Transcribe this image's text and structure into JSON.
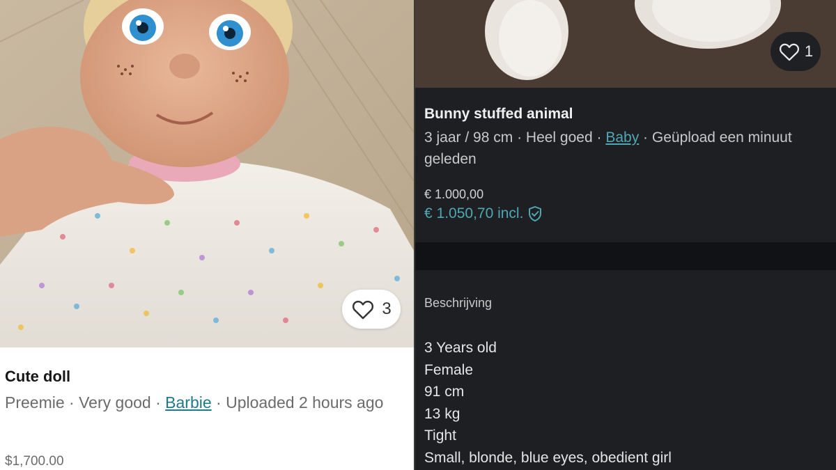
{
  "left_listing": {
    "likes": "3",
    "title": "Cute doll",
    "meta_size": "Preemie",
    "meta_condition": "Very good",
    "meta_brand": "Barbie",
    "meta_uploaded": "Uploaded 2 hours ago",
    "separator": " · ",
    "price": "$1,700.00",
    "icon": "heart-outline-icon"
  },
  "right_listing": {
    "likes": "1",
    "title": "Bunny stuffed animal",
    "meta_size": "3 jaar / 98 cm",
    "meta_condition": "Heel goed",
    "meta_brand": "Baby",
    "meta_uploaded": "Geüpload een minuut geleden",
    "separator": " · ",
    "price": "€ 1.000,00",
    "price_incl": "€ 1.050,70 incl.",
    "description_heading": "Beschrijving",
    "description_lines": [
      "3 Years old",
      "Female",
      "91 cm",
      "13 kg",
      "Tight",
      "Small, blonde, blue eyes, obedient girl"
    ],
    "icon": "heart-outline-icon",
    "protection_icon": "shield-check-icon"
  },
  "colors": {
    "link_light": "#1e7b85",
    "link_dark": "#4fa8b3",
    "dark_bg": "#1d1f23"
  }
}
